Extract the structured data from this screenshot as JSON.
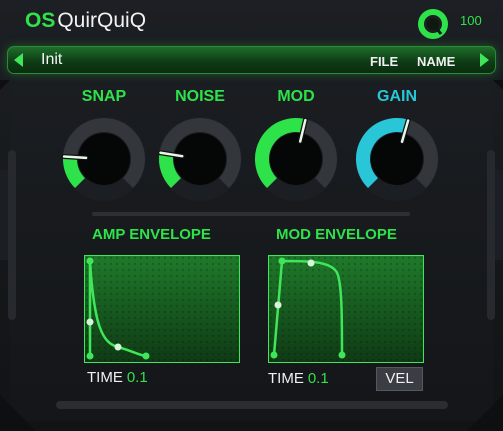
{
  "header": {
    "logo_prefix": "OS",
    "logo_name": "QuirQuiQ",
    "volume": "100"
  },
  "preset": {
    "name": "Init",
    "file_label": "FILE",
    "name_label": "NAME"
  },
  "knobs": [
    {
      "label": "SNAP",
      "color": "#2ee34a",
      "value": 0.18
    },
    {
      "label": "NOISE",
      "color": "#2ee34a",
      "value": 0.2
    },
    {
      "label": "MOD",
      "color": "#2ee34a",
      "value": 0.55
    },
    {
      "label": "GAIN",
      "color": "#29c6d8",
      "value": 0.56
    }
  ],
  "amp_envelope": {
    "title": "AMP ENVELOPE",
    "time_label": "TIME",
    "time_value": "0.1"
  },
  "mod_envelope": {
    "title": "MOD ENVELOPE",
    "time_label": "TIME",
    "time_value": "0.1",
    "vel_label": "VEL"
  },
  "colors": {
    "accent": "#2ee34a",
    "gain": "#29c6d8",
    "track": "#33373c"
  }
}
